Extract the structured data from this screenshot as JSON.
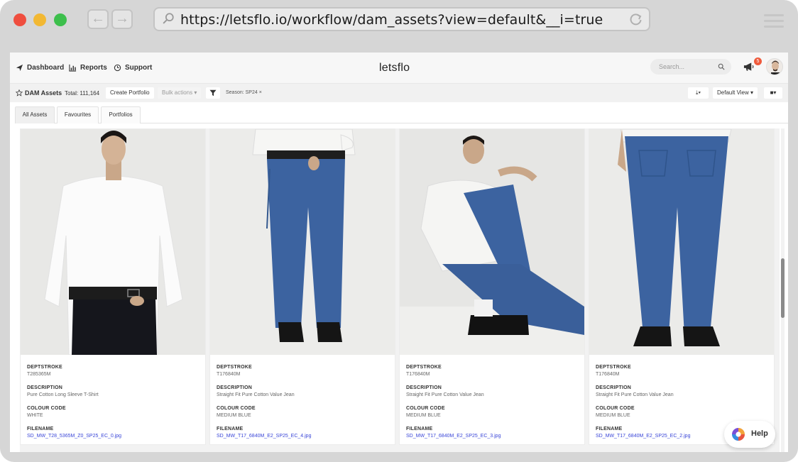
{
  "browser": {
    "url": "https://letsflo.io/workflow/dam_assets?view=default&__i=true",
    "back_icon": "arrow-left-icon",
    "forward_icon": "arrow-right-icon"
  },
  "topnav": {
    "links": [
      {
        "label": "Dashboard",
        "icon": "send-icon"
      },
      {
        "label": "Reports",
        "icon": "bar-chart-icon"
      },
      {
        "label": "Support",
        "icon": "support-icon"
      }
    ],
    "logo": "letsflo",
    "search_placeholder": "Search...",
    "notification_count": "5"
  },
  "toolbar": {
    "title": "DAM Assets",
    "total": "Total: 111,164",
    "create_portfolio": "Create Portfolio",
    "bulk_actions": "Bulk actions ▾",
    "filter_chip": "Season: SP24  ×",
    "default_view": "Default View ▾",
    "download_menu": "⤓▾",
    "view_menu": "■▾"
  },
  "tabs": [
    {
      "label": "All Assets",
      "active": true
    },
    {
      "label": "Favourites",
      "active": false
    },
    {
      "label": "Portfolios",
      "active": false
    }
  ],
  "field_labels": {
    "deptstroke": "DEPTSTROKE",
    "description": "DESCRIPTION",
    "colour_code": "COLOUR CODE",
    "filename": "FILENAME"
  },
  "assets": [
    {
      "deptstroke": "T285365M",
      "description": "Pure Cotton Long Sleeve T-Shirt",
      "colour_code": "WHITE",
      "filename": "SD_MW_T28_5365M_Z0_SP25_EC_0.jpg"
    },
    {
      "deptstroke": "T176840M",
      "description": "Straight Fit Pure Cotton Value Jean",
      "colour_code": "MEDIUM BLUE",
      "filename": "SD_MW_T17_6840M_E2_SP25_EC_4.jpg"
    },
    {
      "deptstroke": "T176840M",
      "description": "Straight Fit Pure Cotton Value Jean",
      "colour_code": "MEDIUM BLUE",
      "filename": "SD_MW_T17_6840M_E2_SP25_EC_3.jpg"
    },
    {
      "deptstroke": "T176840M",
      "description": "Straight Fit Pure Cotton Value Jean",
      "colour_code": "MEDIUM BLUE",
      "filename": "SD_MW_T17_6840M_E2_SP25_EC_2.jpg"
    }
  ],
  "help": {
    "label": "Help"
  },
  "colors": {
    "link": "#3a46d8",
    "badge": "#ef5a3c",
    "denim": "#3c63a0"
  }
}
